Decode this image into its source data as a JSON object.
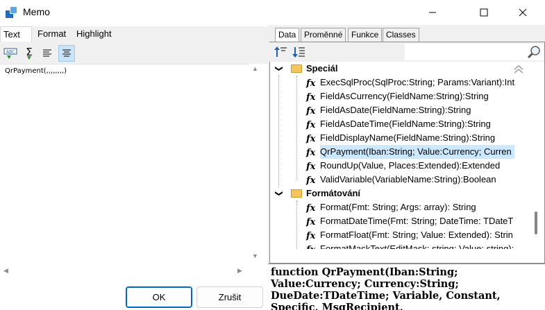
{
  "window": {
    "title": "Memo"
  },
  "left_tabs": [
    "Text",
    "Format",
    "Highlight"
  ],
  "editor": {
    "content": "QrPayment(,,,,,,,,)"
  },
  "buttons": {
    "ok": "OK",
    "cancel": "Zrušit"
  },
  "right_tabs": [
    "Data",
    "Proměnné",
    "Funkce",
    "Classes"
  ],
  "tree": {
    "categories": [
      {
        "name": "Speciál",
        "items": [
          "ExecSqlProc(SqlProc:String; Params:Variant):Int",
          "FieldAsCurrency(FieldName:String):String",
          "FieldAsDate(FieldName:String):String",
          "FieldAsDateTime(FieldName:String):String",
          "FieldDisplayName(FieldName:String):String",
          "QrPayment(Iban:String; Value:Currency; Curren",
          "RoundUp(Value, Places:Extended):Extended",
          "ValidVariable(VariableName:String):Boolean"
        ],
        "selected_index": 5
      },
      {
        "name": "Formátování",
        "items": [
          "Format(Fmt: String; Args: array): String",
          "FormatDateTime(Fmt: String; DateTime: TDateT",
          "FormatFloat(Fmt: String; Value: Extended): Strin",
          "FormatMaskText(EditMask: string; Value: string):"
        ]
      }
    ]
  },
  "description": "function QrPayment(Iban:String; Value:Currency; Currency:String; DueDate:TDateTime; Variable, Constant, Specific, MsgRecipient, Reference:String):String",
  "colors": {
    "selection": "#cce8ff",
    "accent": "#0067c0",
    "folder": "#f3c55b"
  }
}
